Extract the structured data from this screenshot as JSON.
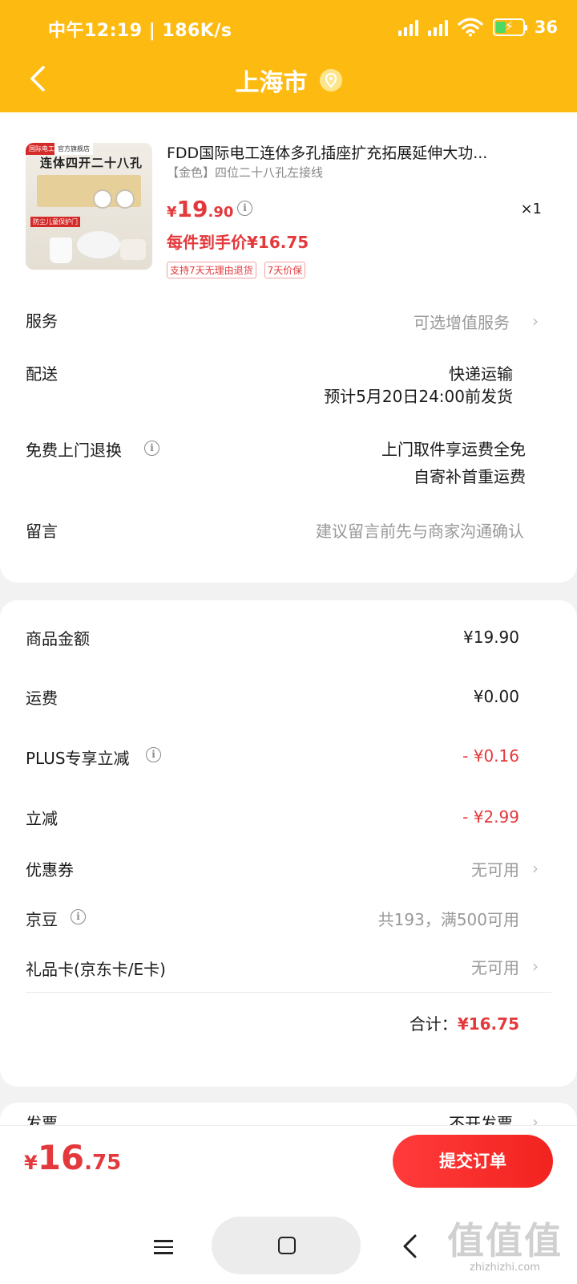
{
  "status_bar": {
    "time": "中午12:19 | 186K/s",
    "battery": "36"
  },
  "header": {
    "city": "上海市",
    "colors": {
      "header_bg": "#fdbb12",
      "accent_red": "#e4393c"
    }
  },
  "product": {
    "image_text": {
      "tag": "国际电工",
      "store": "官方旗舰店",
      "title": "连体四开二十八孔",
      "badge": "防尘儿童保护门"
    },
    "title": "FDD国际电工连体多孔插座扩充拓展延伸大功...",
    "spec": "【金色】四位二十八孔左接线",
    "price_currency": "¥",
    "price_int": "19",
    "price_dec": ".90",
    "quantity": "×1",
    "hand_price": "每件到手价¥16.75",
    "badges": [
      "支持7天无理由退货",
      "7天价保"
    ]
  },
  "order_options": {
    "service_label": "服务",
    "service_value": "可选增值服务",
    "delivery_label": "配送",
    "delivery_method": "快递运输",
    "delivery_eta": "预计5月20日24:00前发货",
    "return_label": "免费上门退换",
    "return_line1": "上门取件享运费全免",
    "return_line2": "自寄补首重运费",
    "message_label": "留言",
    "message_placeholder": "建议留言前先与商家沟通确认"
  },
  "pricing": {
    "goods_label": "商品金额",
    "goods_value": "¥19.90",
    "shipping_label": "运费",
    "shipping_value": "¥0.00",
    "plus_label": "PLUS专享立减",
    "plus_value": "- ¥0.16",
    "discount_label": "立减",
    "discount_value": "- ¥2.99",
    "coupon_label": "优惠券",
    "coupon_value": "无可用",
    "jingdou_label": "京豆",
    "jingdou_value": "共193，满500可用",
    "giftcard_label": "礼品卡(京东卡/E卡)",
    "giftcard_value": "无可用",
    "subtotal_label": "合计：",
    "subtotal_value": "¥16.75"
  },
  "invoice": {
    "label": "发票",
    "value": "不开发票"
  },
  "footer": {
    "total_currency": "¥",
    "total_int": "16",
    "total_dec": ".75",
    "submit_label": "提交订单"
  },
  "watermark": {
    "big": "值值值",
    "small": "zhizhizhi.com"
  }
}
